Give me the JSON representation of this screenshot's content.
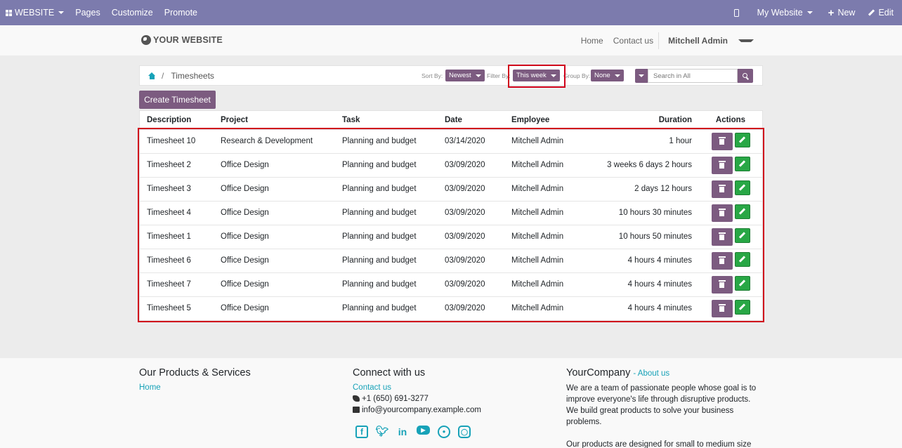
{
  "adminbar": {
    "brand": "WEBSITE",
    "menu": [
      "Pages",
      "Customize",
      "Promote"
    ],
    "site_selector": "My Website",
    "new_label": "New",
    "edit_label": "Edit"
  },
  "site": {
    "logo": "YOUR WEBSITE",
    "nav": [
      "Home",
      "Contact us"
    ],
    "user": "Mitchell Admin"
  },
  "breadcrumb": {
    "current": "Timesheets"
  },
  "filters": {
    "sort_label": "Sort By:",
    "sort_value": "Newest",
    "filter_label": "Filter By:",
    "filter_value": "This week",
    "group_label": "Group By:",
    "group_value": "None",
    "search_placeholder": "Search in All"
  },
  "create_button": "Create Timesheet",
  "table": {
    "headers": {
      "description": "Description",
      "project": "Project",
      "task": "Task",
      "date": "Date",
      "employee": "Employee",
      "duration": "Duration",
      "actions": "Actions"
    },
    "rows": [
      {
        "description": "Timesheet 10",
        "project": "Research & Development",
        "task": "Planning and budget",
        "date": "03/14/2020",
        "employee": "Mitchell Admin",
        "duration": "1 hour"
      },
      {
        "description": "Timesheet 2",
        "project": "Office Design",
        "task": "Planning and budget",
        "date": "03/09/2020",
        "employee": "Mitchell Admin",
        "duration": "3 weeks 6 days 2 hours"
      },
      {
        "description": "Timesheet 3",
        "project": "Office Design",
        "task": "Planning and budget",
        "date": "03/09/2020",
        "employee": "Mitchell Admin",
        "duration": "2 days 12 hours"
      },
      {
        "description": "Timesheet 4",
        "project": "Office Design",
        "task": "Planning and budget",
        "date": "03/09/2020",
        "employee": "Mitchell Admin",
        "duration": "10 hours 30 minutes"
      },
      {
        "description": "Timesheet 1",
        "project": "Office Design",
        "task": "Planning and budget",
        "date": "03/09/2020",
        "employee": "Mitchell Admin",
        "duration": "10 hours 50 minutes"
      },
      {
        "description": "Timesheet 6",
        "project": "Office Design",
        "task": "Planning and budget",
        "date": "03/09/2020",
        "employee": "Mitchell Admin",
        "duration": "4 hours 4 minutes"
      },
      {
        "description": "Timesheet 7",
        "project": "Office Design",
        "task": "Planning and budget",
        "date": "03/09/2020",
        "employee": "Mitchell Admin",
        "duration": "4 hours 4 minutes"
      },
      {
        "description": "Timesheet 5",
        "project": "Office Design",
        "task": "Planning and budget",
        "date": "03/09/2020",
        "employee": "Mitchell Admin",
        "duration": "4 hours 4 minutes"
      }
    ]
  },
  "footer": {
    "col1": {
      "title": "Our Products & Services",
      "link": "Home"
    },
    "col2": {
      "title": "Connect with us",
      "link": "Contact us",
      "phone": "+1 (650) 691-3277",
      "email": "info@yourcompany.example.com"
    },
    "col3": {
      "title": "YourCompany",
      "about": "About us",
      "p1": "We are a team of passionate people whose goal is to improve everyone's life through disruptive products. We build great products to solve your business problems.",
      "p2": "Our products are designed for small to medium size companies willing to optimize their performance."
    },
    "social_icons": [
      "facebook-icon",
      "twitter-icon",
      "linkedin-icon",
      "youtube-icon",
      "github-icon",
      "instagram-icon"
    ]
  },
  "colors": {
    "adminbar": "#7c7bad",
    "primary": "#7c5b80",
    "success": "#28a745",
    "link": "#17a2b8",
    "highlight": "#d0021b"
  }
}
